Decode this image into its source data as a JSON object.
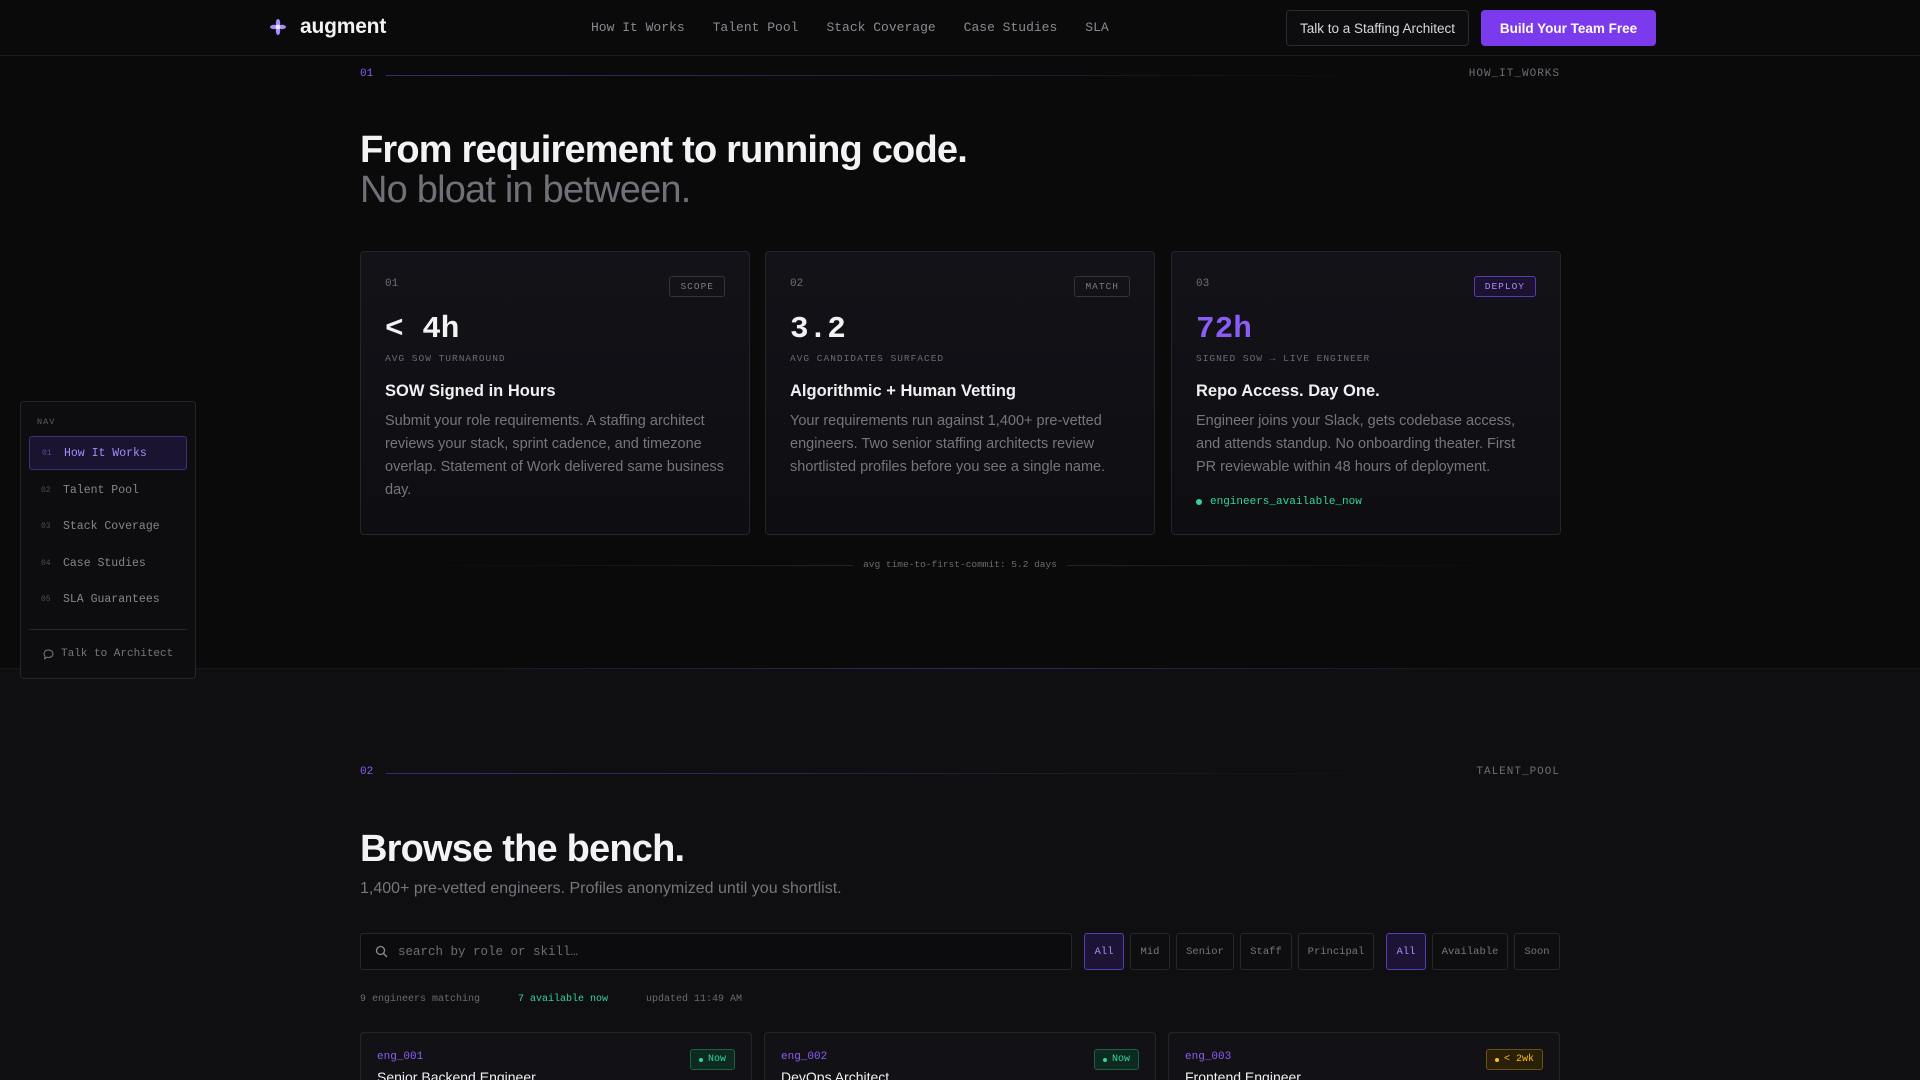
{
  "brand": {
    "name": "augment"
  },
  "topnav": {
    "links": [
      "How It Works",
      "Talent Pool",
      "Stack Coverage",
      "Case Studies",
      "SLA"
    ],
    "cta_secondary": "Talk to a Staffing Architect",
    "cta_primary": "Build Your Team Free"
  },
  "section1": {
    "num": "01",
    "tag": "HOW_IT_WORKS",
    "title": "From requirement to running code.",
    "subtitle": "No bloat in between.",
    "cards": [
      {
        "num": "01",
        "badge": "SCOPE",
        "metric": "< 4h",
        "metric_label": "AVG SOW TURNAROUND",
        "title": "SOW Signed in Hours",
        "body": "Submit your role requirements. A staffing architect reviews your stack, sprint cadence, and timezone overlap. Statement of Work delivered same business day."
      },
      {
        "num": "02",
        "badge": "MATCH",
        "metric": "3.2",
        "metric_label": "AVG CANDIDATES SURFACED",
        "title": "Algorithmic + Human Vetting",
        "body": "Your requirements run against 1,400+ pre-vetted engineers. Two senior staffing architects review shortlisted profiles before you see a single name."
      },
      {
        "num": "03",
        "badge": "DEPLOY",
        "metric": "72h",
        "metric_label": "SIGNED SOW → LIVE ENGINEER",
        "title": "Repo Access. Day One.",
        "body": "Engineer joins your Slack, gets codebase access, and attends standup. No onboarding theater. First PR reviewable within 48 hours of deployment.",
        "status": "engineers_available_now"
      }
    ],
    "footnote": "avg time-to-first-commit: 5.2 days"
  },
  "section2": {
    "num": "02",
    "tag": "TALENT_POOL",
    "title": "Browse the bench.",
    "subtitle": "1,400+ pre-vetted engineers. Profiles anonymized until you shortlist.",
    "search_placeholder": "search by role or skill…",
    "level_filters": [
      "All",
      "Mid",
      "Senior",
      "Staff",
      "Principal"
    ],
    "availability_filters": [
      "All",
      "Available",
      "Soon"
    ],
    "meta_count": "9 engineers matching",
    "meta_available": "7 available now",
    "meta_updated": "updated 11:49 AM",
    "engineers": [
      {
        "id": "eng_001",
        "title": "Senior Backend Engineer",
        "status": "Now"
      },
      {
        "id": "eng_002",
        "title": "DevOps Architect",
        "status": "Now"
      },
      {
        "id": "eng_003",
        "title": "Frontend Engineer",
        "status": "< 2wk"
      }
    ]
  },
  "sidenav": {
    "label": "NAV",
    "items": [
      {
        "num": "01",
        "label": "How It Works"
      },
      {
        "num": "02",
        "label": "Talent Pool"
      },
      {
        "num": "03",
        "label": "Stack Coverage"
      },
      {
        "num": "04",
        "label": "Case Studies"
      },
      {
        "num": "05",
        "label": "SLA Guarantees"
      }
    ],
    "talk": "Talk to Architect"
  },
  "colors": {
    "accent": "#7c3aed",
    "accent_light": "#8b5cf6",
    "green": "#34d399",
    "amber": "#fbbf24"
  }
}
